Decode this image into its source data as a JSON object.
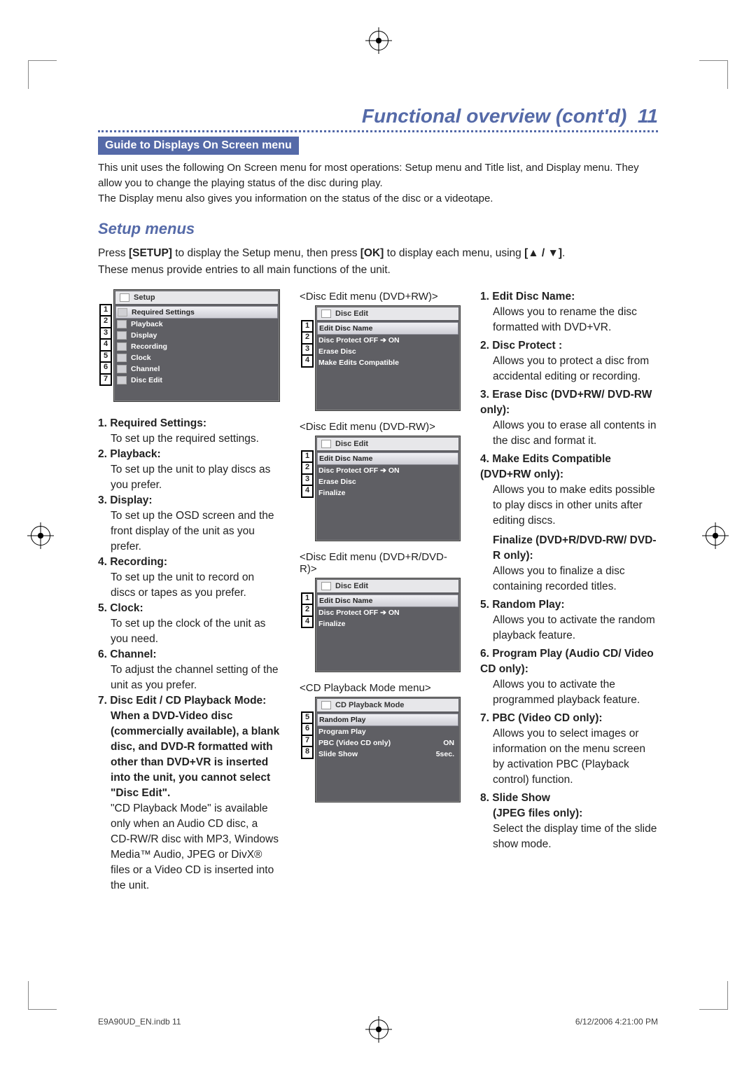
{
  "header": {
    "title": "Functional overview (cont'd)",
    "page_num": "11"
  },
  "banner": "Guide to Displays On Screen menu",
  "intro_lines": [
    "This unit uses the following On Screen menu for most operations: Setup menu and Title list, and Display menu. They allow you to change the playing status of the disc during play.",
    "The Display menu also gives you information on the status of the disc or a videotape."
  ],
  "section_heading": "Setup menus",
  "instructions": {
    "pre": "Press ",
    "key1": "[SETUP]",
    "mid1": " to display the Setup menu, then press ",
    "key2": "[OK]",
    "mid2": " to display each menu, using ",
    "arrows": "[▲ / ▼]",
    "post": ".",
    "line2": "These menus provide entries to all main functions of the unit."
  },
  "setup_menu": {
    "title": "Setup",
    "items": [
      "Required Settings",
      "Playback",
      "Display",
      "Recording",
      "Clock",
      "Channel",
      "Disc Edit"
    ]
  },
  "left_list": [
    {
      "title": "Required Settings:",
      "body": "To set up the required settings."
    },
    {
      "title": "Playback:",
      "body": "To set up the unit to play discs as you prefer."
    },
    {
      "title": "Display:",
      "body": "To set up the OSD screen and the front display of the unit as you prefer."
    },
    {
      "title": "Recording:",
      "body": "To set up the unit to record on discs or tapes as you prefer."
    },
    {
      "title": "Clock:",
      "body": "To set up the clock of the unit as you need."
    },
    {
      "title": "Channel:",
      "body": "To adjust the channel setting of the unit as you prefer."
    },
    {
      "title": "Disc Edit / CD Playback Mode:",
      "bold_lead": "When a DVD-Video disc (commercially available), a blank disc, and DVD-R formatted with other than DVD+VR is inserted into the unit, you cannot select \"Disc Edit\".",
      "body": "\"CD Playback Mode\" is available only when an Audio CD disc, a CD-RW/R disc with MP3, Windows Media™ Audio, JPEG or DivX® files or a Video CD is inserted into the unit."
    }
  ],
  "center_panels": [
    {
      "caption": "<Disc Edit menu (DVD+RW)>",
      "title": "Disc Edit",
      "nums": [
        "1",
        "2",
        "3",
        "4"
      ],
      "rows": [
        {
          "l": "Edit Disc Name"
        },
        {
          "l": "Disc Protect OFF ➔ ON"
        },
        {
          "l": "Erase Disc"
        },
        {
          "l": "Make Edits Compatible"
        }
      ]
    },
    {
      "caption": "<Disc Edit menu (DVD-RW)>",
      "title": "Disc Edit",
      "nums": [
        "1",
        "2",
        "3",
        "4"
      ],
      "rows": [
        {
          "l": "Edit Disc Name"
        },
        {
          "l": "Disc Protect OFF ➔ ON"
        },
        {
          "l": "Erase Disc"
        },
        {
          "l": "Finalize"
        }
      ]
    },
    {
      "caption": "<Disc Edit menu (DVD+R/DVD-R)>",
      "title": "Disc Edit",
      "nums": [
        "1",
        "2",
        "4"
      ],
      "rows": [
        {
          "l": "Edit Disc Name"
        },
        {
          "l": "Disc Protect OFF ➔ ON"
        },
        {
          "l": "Finalize"
        }
      ]
    },
    {
      "caption": "<CD Playback Mode menu>",
      "title": "CD Playback Mode",
      "nums": [
        "5",
        "6",
        "7",
        "8"
      ],
      "rows": [
        {
          "l": "Random Play",
          "v": ""
        },
        {
          "l": "Program Play",
          "v": ""
        },
        {
          "l": "PBC (Video CD only)",
          "v": "ON"
        },
        {
          "l": "Slide Show",
          "v": "5sec."
        }
      ]
    }
  ],
  "right_list": [
    {
      "title": "Edit Disc Name:",
      "body": "Allows you to rename the disc formatted with DVD+VR."
    },
    {
      "title": "Disc Protect :",
      "body": "Allows you to protect a disc from accidental editing or recording."
    },
    {
      "title": "Erase Disc (DVD+RW/ DVD-RW only):",
      "body": "Allows you to erase all contents in the disc and format it."
    },
    {
      "title": "Make Edits Compatible (DVD+RW only):",
      "body": "Allows you to make edits possible to play discs in other units after editing discs.",
      "extra_heading": "Finalize (DVD+R/DVD-RW/ DVD-R only):",
      "extra_body": "Allows you to finalize a disc containing recorded titles."
    },
    {
      "title": "Random Play:",
      "body": "Allows you to activate the random playback feature."
    },
    {
      "title": "Program Play (Audio CD/ Video CD only):",
      "body": "Allows you to activate the programmed playback feature."
    },
    {
      "title": "PBC (Video CD only):",
      "body": "Allows you to select images or information on the menu screen by activation PBC (Playback control) function."
    },
    {
      "title": "Slide Show",
      "subtitle": "(JPEG files only):",
      "body": "Select the display time of the slide show mode."
    }
  ],
  "footer": {
    "file": "E9A90UD_EN.indb   11",
    "date": "6/12/2006   4:21:00 PM"
  }
}
